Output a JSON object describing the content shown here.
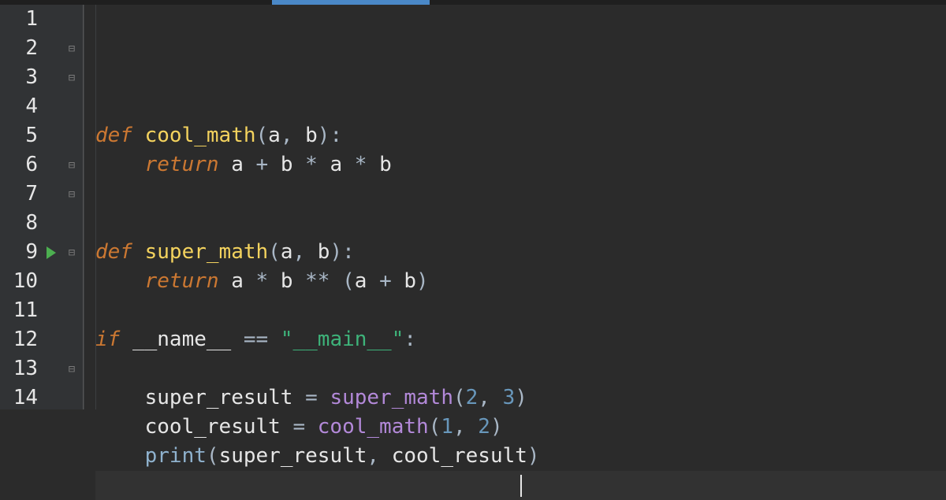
{
  "tab_indicator": {
    "present": true
  },
  "run_marker_line": 9,
  "cursor_line": 14,
  "gutter": {
    "line_numbers": [
      "1",
      "2",
      "3",
      "4",
      "5",
      "6",
      "7",
      "8",
      "9",
      "10",
      "11",
      "12",
      "13",
      "14"
    ],
    "fold_markers": {
      "2": "open",
      "3": "close",
      "6": "open",
      "7": "close",
      "9": "open",
      "13": "close"
    }
  },
  "code": {
    "lines": [
      [],
      [
        {
          "t": "def ",
          "c": "kw"
        },
        {
          "t": "cool_math",
          "c": "fn"
        },
        {
          "t": "(",
          "c": "par"
        },
        {
          "t": "a",
          "c": "var"
        },
        {
          "t": ", ",
          "c": "par"
        },
        {
          "t": "b",
          "c": "var"
        },
        {
          "t": ")",
          "c": "par"
        },
        {
          "t": ":",
          "c": "par"
        }
      ],
      [
        {
          "t": "    ",
          "c": "var"
        },
        {
          "t": "return ",
          "c": "kw"
        },
        {
          "t": "a",
          "c": "var"
        },
        {
          "t": " + ",
          "c": "op"
        },
        {
          "t": "b",
          "c": "var"
        },
        {
          "t": " * ",
          "c": "op"
        },
        {
          "t": "a",
          "c": "var"
        },
        {
          "t": " * ",
          "c": "op"
        },
        {
          "t": "b",
          "c": "var"
        }
      ],
      [],
      [],
      [
        {
          "t": "def ",
          "c": "kw"
        },
        {
          "t": "super_math",
          "c": "fn"
        },
        {
          "t": "(",
          "c": "par"
        },
        {
          "t": "a",
          "c": "var"
        },
        {
          "t": ", ",
          "c": "par"
        },
        {
          "t": "b",
          "c": "var"
        },
        {
          "t": ")",
          "c": "par"
        },
        {
          "t": ":",
          "c": "par"
        }
      ],
      [
        {
          "t": "    ",
          "c": "var"
        },
        {
          "t": "return ",
          "c": "kw"
        },
        {
          "t": "a",
          "c": "var"
        },
        {
          "t": " * ",
          "c": "op"
        },
        {
          "t": "b",
          "c": "var"
        },
        {
          "t": " ** ",
          "c": "op"
        },
        {
          "t": "(",
          "c": "par"
        },
        {
          "t": "a",
          "c": "var"
        },
        {
          "t": " + ",
          "c": "op"
        },
        {
          "t": "b",
          "c": "var"
        },
        {
          "t": ")",
          "c": "par"
        }
      ],
      [],
      [
        {
          "t": "if ",
          "c": "kw"
        },
        {
          "t": "__name__",
          "c": "name"
        },
        {
          "t": " == ",
          "c": "op"
        },
        {
          "t": "\"__main__\"",
          "c": "str"
        },
        {
          "t": ":",
          "c": "par"
        }
      ],
      [],
      [
        {
          "t": "    ",
          "c": "var"
        },
        {
          "t": "super_result",
          "c": "var"
        },
        {
          "t": " = ",
          "c": "op"
        },
        {
          "t": "super_math",
          "c": "call"
        },
        {
          "t": "(",
          "c": "par"
        },
        {
          "t": "2",
          "c": "num"
        },
        {
          "t": ", ",
          "c": "par"
        },
        {
          "t": "3",
          "c": "num"
        },
        {
          "t": ")",
          "c": "par"
        }
      ],
      [
        {
          "t": "    ",
          "c": "var"
        },
        {
          "t": "cool_result",
          "c": "var"
        },
        {
          "t": " = ",
          "c": "op"
        },
        {
          "t": "cool_math",
          "c": "call"
        },
        {
          "t": "(",
          "c": "par"
        },
        {
          "t": "1",
          "c": "num"
        },
        {
          "t": ", ",
          "c": "par"
        },
        {
          "t": "2",
          "c": "num"
        },
        {
          "t": ")",
          "c": "par"
        }
      ],
      [
        {
          "t": "    ",
          "c": "var"
        },
        {
          "t": "print",
          "c": "bi"
        },
        {
          "t": "(",
          "c": "par"
        },
        {
          "t": "super_result",
          "c": "var"
        },
        {
          "t": ", ",
          "c": "par"
        },
        {
          "t": "cool_result",
          "c": "var"
        },
        {
          "t": ")",
          "c": "par"
        }
      ],
      []
    ]
  },
  "fold_glyphs": {
    "open": "⊟",
    "close": "⊟"
  }
}
